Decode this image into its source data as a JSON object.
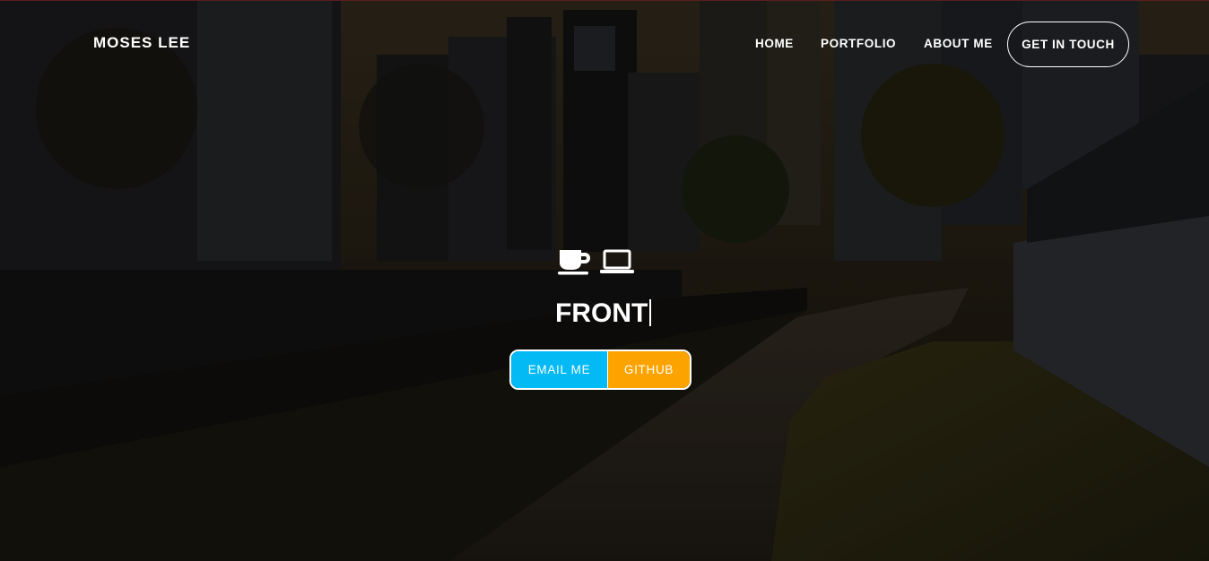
{
  "nav": {
    "brand": "MOSES LEE",
    "links": [
      "HOME",
      "PORTFOLIO",
      "ABOUT ME"
    ],
    "cta": "GET IN TOUCH"
  },
  "hero": {
    "icons": [
      "coffee-icon",
      "laptop-icon"
    ],
    "typed_text": "FRONT",
    "buttons": {
      "email": "EMAIL ME",
      "github": "GITHUB"
    }
  },
  "colors": {
    "email_button": "#04baf5",
    "github_button": "#fca300",
    "text": "#ffffff"
  }
}
